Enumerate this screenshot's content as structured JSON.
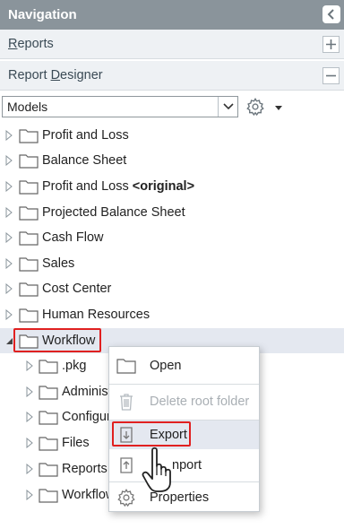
{
  "navigation": {
    "title": "Navigation",
    "sections": [
      {
        "label_pre": "",
        "label_ul": "R",
        "label_post": "eports",
        "state": "collapsed"
      },
      {
        "label_pre": "Report ",
        "label_ul": "D",
        "label_post": "esigner",
        "state": "expanded"
      }
    ]
  },
  "designer": {
    "selected_type": "Models"
  },
  "tree": {
    "items": [
      {
        "label": "Profit and Loss",
        "bold_suffix": ""
      },
      {
        "label": "Balance Sheet",
        "bold_suffix": ""
      },
      {
        "label": "Profit and Loss ",
        "bold_suffix": "<original>"
      },
      {
        "label": "Projected Balance Sheet",
        "bold_suffix": ""
      },
      {
        "label": "Cash Flow",
        "bold_suffix": ""
      },
      {
        "label": "Sales",
        "bold_suffix": ""
      },
      {
        "label": "Cost Center",
        "bold_suffix": ""
      },
      {
        "label": "Human Resources",
        "bold_suffix": ""
      },
      {
        "label": "Workflow",
        "bold_suffix": "",
        "expanded": true,
        "selected": true
      }
    ],
    "children": [
      {
        "label": ".pkg"
      },
      {
        "label": "Administ"
      },
      {
        "label": "Configur"
      },
      {
        "label": "Files"
      },
      {
        "label": "Reports"
      },
      {
        "label": "Workflow"
      }
    ]
  },
  "context_menu": {
    "items": [
      {
        "label": "Open",
        "icon": "folder-icon",
        "enabled": true
      },
      {
        "label": "Delete root folder",
        "icon": "trash-icon",
        "enabled": false
      },
      {
        "label": "Export",
        "icon": "export-icon",
        "enabled": true,
        "active": true
      },
      {
        "label": "Import",
        "visible_label": "nport",
        "icon": "import-icon",
        "enabled": true
      },
      {
        "label": "Properties",
        "icon": "gear-icon",
        "enabled": true
      }
    ]
  },
  "colors": {
    "header_bg": "#8a949b",
    "section_bg": "#eef1f4",
    "selection_bg": "#e4e8f0",
    "highlight": "#e02020"
  }
}
